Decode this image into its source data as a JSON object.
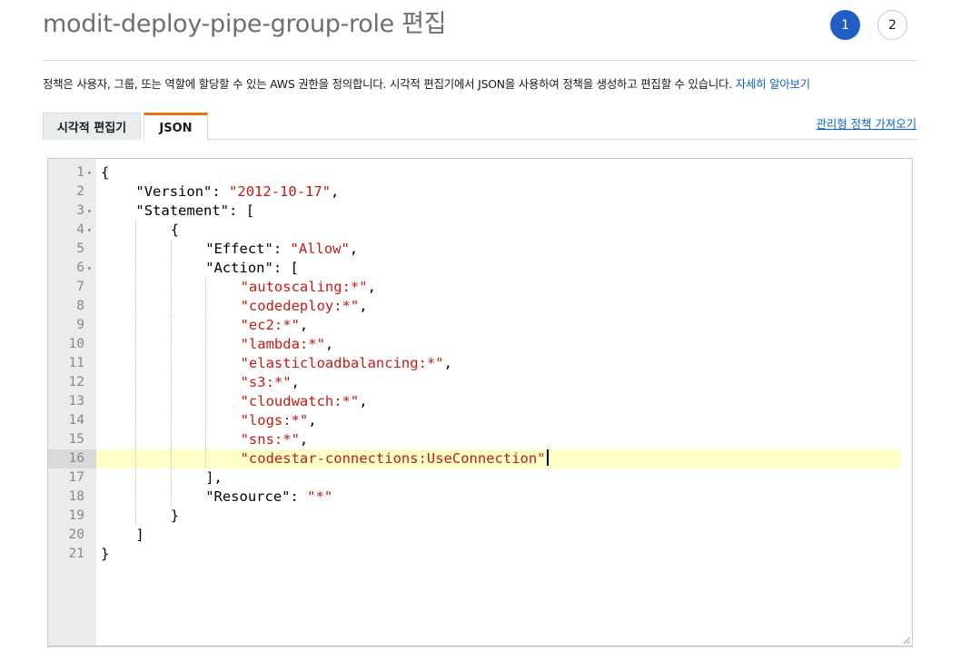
{
  "header": {
    "title": "modit-deploy-pipe-group-role 편집",
    "steps": [
      "1",
      "2"
    ]
  },
  "description": {
    "text": "정책은 사용자, 그룹, 또는 역할에 할당할 수 있는 AWS 권한을 정의합니다. 시각적 편집기에서 JSON을 사용하여 정책을 생성하고 편집할 수 있습니다. ",
    "link": "자세히 알아보기"
  },
  "tabs": {
    "visual_editor": "시각적 편집기",
    "json": "JSON"
  },
  "import_link": "관리형 정책 가져오기",
  "editor": {
    "lines": [
      {
        "n": "1",
        "fold": true,
        "indent": 0,
        "parts": [
          [
            "p",
            "{"
          ]
        ]
      },
      {
        "n": "2",
        "fold": false,
        "indent": 1,
        "parts": [
          [
            "p",
            "\"Version\": "
          ],
          [
            "s",
            "\"2012-10-17\""
          ],
          [
            "p",
            ","
          ]
        ]
      },
      {
        "n": "3",
        "fold": true,
        "indent": 1,
        "parts": [
          [
            "p",
            "\"Statement\": ["
          ]
        ]
      },
      {
        "n": "4",
        "fold": true,
        "indent": 2,
        "parts": [
          [
            "p",
            "{"
          ]
        ]
      },
      {
        "n": "5",
        "fold": false,
        "indent": 3,
        "parts": [
          [
            "p",
            "\"Effect\": "
          ],
          [
            "s",
            "\"Allow\""
          ],
          [
            "p",
            ","
          ]
        ]
      },
      {
        "n": "6",
        "fold": true,
        "indent": 3,
        "parts": [
          [
            "p",
            "\"Action\": ["
          ]
        ]
      },
      {
        "n": "7",
        "fold": false,
        "indent": 4,
        "parts": [
          [
            "s",
            "\"autoscaling:*\""
          ],
          [
            "p",
            ","
          ]
        ]
      },
      {
        "n": "8",
        "fold": false,
        "indent": 4,
        "parts": [
          [
            "s",
            "\"codedeploy:*\""
          ],
          [
            "p",
            ","
          ]
        ]
      },
      {
        "n": "9",
        "fold": false,
        "indent": 4,
        "parts": [
          [
            "s",
            "\"ec2:*\""
          ],
          [
            "p",
            ","
          ]
        ]
      },
      {
        "n": "10",
        "fold": false,
        "indent": 4,
        "parts": [
          [
            "s",
            "\"lambda:*\""
          ],
          [
            "p",
            ","
          ]
        ]
      },
      {
        "n": "11",
        "fold": false,
        "indent": 4,
        "parts": [
          [
            "s",
            "\"elasticloadbalancing:*\""
          ],
          [
            "p",
            ","
          ]
        ]
      },
      {
        "n": "12",
        "fold": false,
        "indent": 4,
        "parts": [
          [
            "s",
            "\"s3:*\""
          ],
          [
            "p",
            ","
          ]
        ]
      },
      {
        "n": "13",
        "fold": false,
        "indent": 4,
        "parts": [
          [
            "s",
            "\"cloudwatch:*\""
          ],
          [
            "p",
            ","
          ]
        ]
      },
      {
        "n": "14",
        "fold": false,
        "indent": 4,
        "parts": [
          [
            "s",
            "\"logs:*\""
          ],
          [
            "p",
            ","
          ]
        ]
      },
      {
        "n": "15",
        "fold": false,
        "indent": 4,
        "parts": [
          [
            "s",
            "\"sns:*\""
          ],
          [
            "p",
            ","
          ]
        ]
      },
      {
        "n": "16",
        "fold": false,
        "indent": 4,
        "parts": [
          [
            "s",
            "\"codestar-connections:UseConnection\""
          ]
        ],
        "active": true
      },
      {
        "n": "17",
        "fold": false,
        "indent": 3,
        "parts": [
          [
            "p",
            "],"
          ]
        ]
      },
      {
        "n": "18",
        "fold": false,
        "indent": 3,
        "parts": [
          [
            "p",
            "\"Resource\": "
          ],
          [
            "s",
            "\"*\""
          ]
        ]
      },
      {
        "n": "19",
        "fold": false,
        "indent": 2,
        "parts": [
          [
            "p",
            "}"
          ]
        ]
      },
      {
        "n": "20",
        "fold": false,
        "indent": 1,
        "parts": [
          [
            "p",
            "]"
          ]
        ]
      },
      {
        "n": "21",
        "fold": false,
        "indent": 0,
        "parts": [
          [
            "p",
            "}"
          ]
        ]
      }
    ]
  },
  "colors": {
    "primary_step": "#1f5ec7",
    "tab_accent": "#ec7211",
    "link": "#0a63c9",
    "string": "#c41a16",
    "active_line": "#ffffc8"
  }
}
